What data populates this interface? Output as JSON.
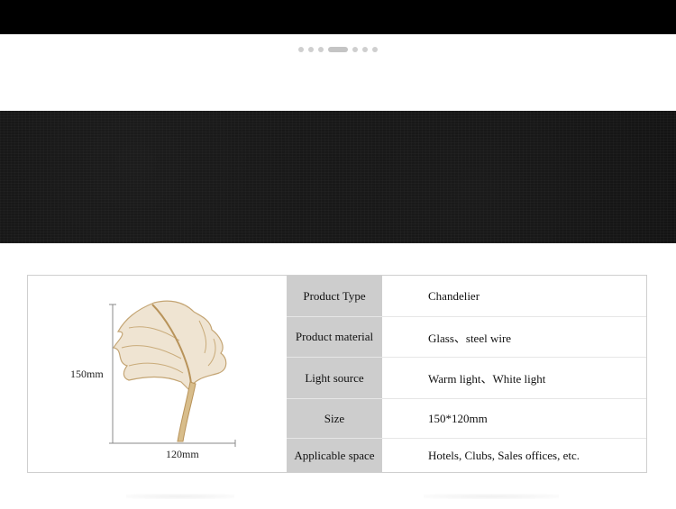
{
  "carousel": {
    "count": 7,
    "active_index": 3
  },
  "dimensions": {
    "height_label": "150mm",
    "width_label": "120mm"
  },
  "specs": [
    {
      "label": "Product Type",
      "value": "Chandelier"
    },
    {
      "label": "Product material",
      "value": "Glass、steel wire"
    },
    {
      "label": "Light source",
      "value": "Warm light、White light"
    },
    {
      "label": "Size",
      "value": "150*120mm"
    },
    {
      "label": "Applicable space",
      "value": "Hotels, Clubs, Sales offices, etc."
    }
  ],
  "colors": {
    "label_bg": "#cdcdcd",
    "banner_bg": "#121212",
    "lamp_gold": "#c9ab7a"
  }
}
